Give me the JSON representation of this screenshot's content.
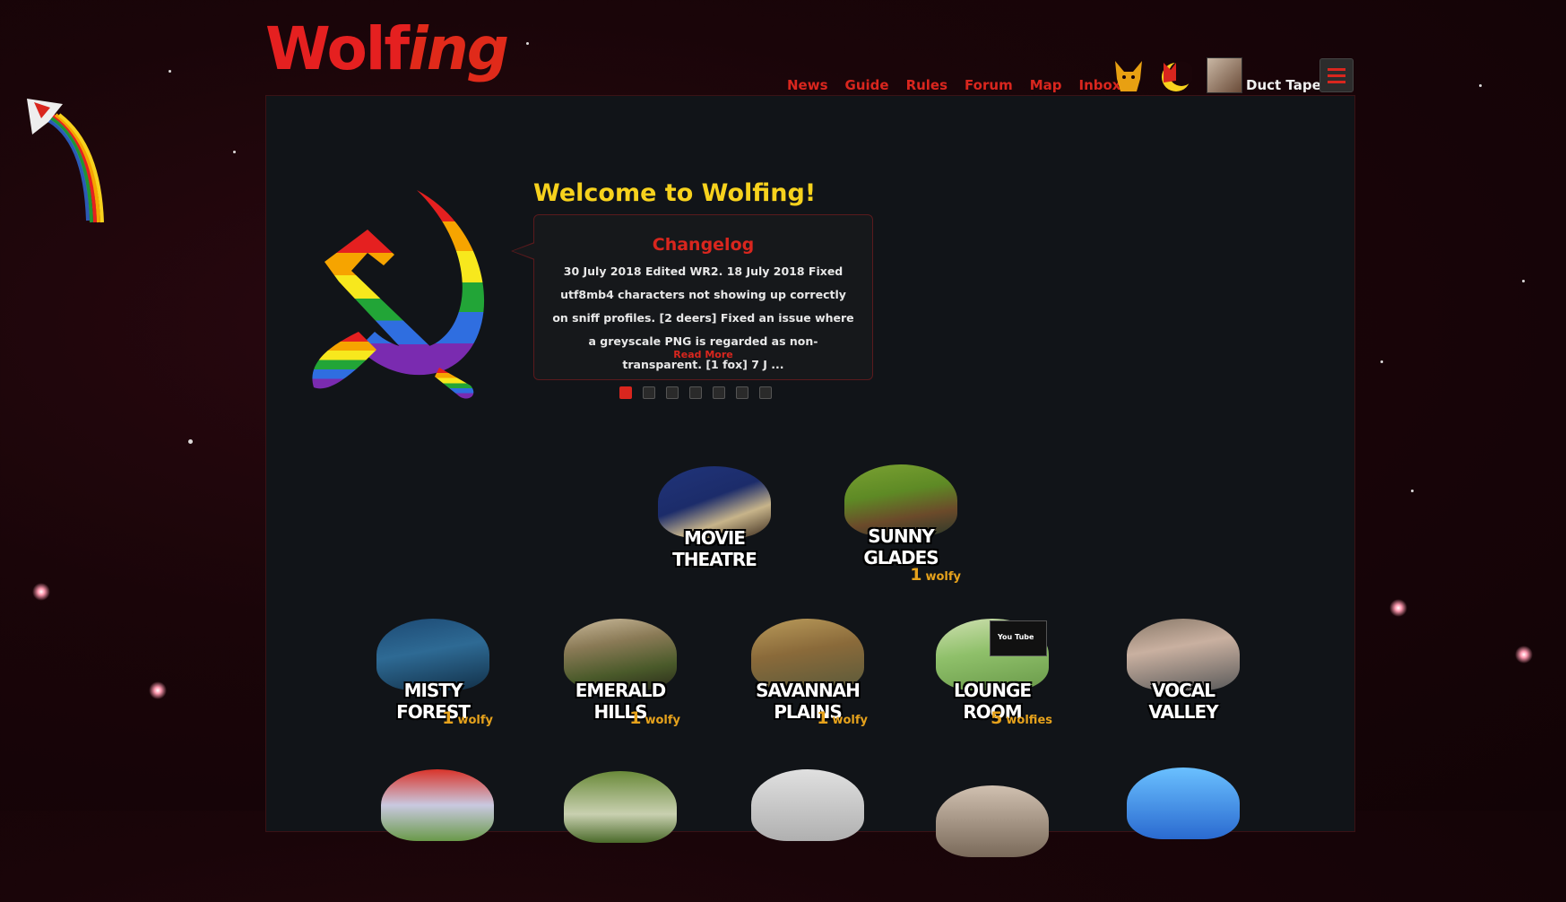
{
  "header": {
    "logo_left": "Wolf",
    "logo_right": "ing",
    "nav": [
      "News",
      "Guide",
      "Rules",
      "Forum",
      "Map",
      "Inbox"
    ],
    "username": "Duct Tape"
  },
  "welcome": {
    "title": "Welcome to Wolfing!",
    "changelog_title": "Changelog",
    "changelog_text": "30 July 2018 Edited WR2. 18 July 2018 Fixed utf8mb4 characters not showing up correctly on sniff profiles. [2 deers] Fixed an issue where a greyscale PNG is regarded as non-transparent. [1 fox] 7 J ...",
    "read_more": "Read More",
    "slide_count": 7,
    "active_slide": 1
  },
  "rooms": [
    {
      "name": "MOVIE THEATRE",
      "count": "",
      "unit": ""
    },
    {
      "name": "SUNNY GLADES",
      "count": "1",
      "unit": "wolfy"
    },
    {
      "name": "MISTY FOREST",
      "count": "1",
      "unit": "wolfy"
    },
    {
      "name": "EMERALD HILLS",
      "count": "1",
      "unit": "wolfy"
    },
    {
      "name": "SAVANNAH PLAINS",
      "count": "1",
      "unit": "wolfy"
    },
    {
      "name": "LOUNGE ROOM",
      "count": "5",
      "unit": "wolfies"
    },
    {
      "name": "VOCAL VALLEY",
      "count": "",
      "unit": ""
    }
  ],
  "youtube_label": "You Tube",
  "colors": {
    "accent": "#d9261e",
    "gold": "#f7d21d",
    "count": "#e6a21c",
    "panel": "#111418"
  }
}
